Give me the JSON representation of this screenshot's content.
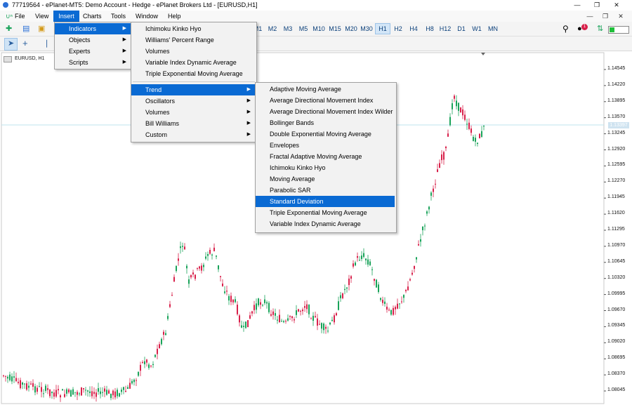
{
  "window": {
    "title": "77719564 - ePlanet-MT5: Demo Account - Hedge - ePlanet Brokers Ltd - [EURUSD,H1]",
    "minimize": "—",
    "maximize": "❐",
    "close": "✕"
  },
  "menubar": {
    "items": [
      "File",
      "View",
      "Insert",
      "Charts",
      "Tools",
      "Window",
      "Help"
    ],
    "active": "Insert"
  },
  "toolbar": {
    "timeframes": [
      "M1",
      "M2",
      "M3",
      "M5",
      "M10",
      "M15",
      "M20",
      "M30",
      "H1",
      "H2",
      "H4",
      "H8",
      "H12",
      "D1",
      "W1",
      "MN"
    ],
    "active_timeframe": "H1",
    "notification_count": "1"
  },
  "chart": {
    "symbol": "EURUSD, H1",
    "current_price": "1.13397",
    "price_labels": [
      "1.14545",
      "1.14220",
      "1.13895",
      "1.13570",
      "1.13245",
      "1.12920",
      "1.12595",
      "1.12270",
      "1.11945",
      "1.11620",
      "1.11295",
      "1.10970",
      "1.10645",
      "1.10320",
      "1.09995",
      "1.09670",
      "1.09345",
      "1.09020",
      "1.08695",
      "1.08370",
      "1.08045"
    ]
  },
  "insert_menu": {
    "items": [
      "Indicators",
      "Objects",
      "Experts",
      "Scripts"
    ],
    "highlighted": "Indicators"
  },
  "indicators_menu": {
    "recent": [
      "Ichimoku Kinko Hyo",
      "Williams' Percent Range",
      "Volumes",
      "Variable Index Dynamic Average",
      "Triple Exponential Moving Average"
    ],
    "categories": [
      "Trend",
      "Oscillators",
      "Volumes",
      "Bill Williams",
      "Custom"
    ],
    "highlighted": "Trend"
  },
  "trend_menu": {
    "items": [
      "Adaptive Moving Average",
      "Average Directional Movement Index",
      "Average Directional Movement Index Wilder",
      "Bollinger Bands",
      "Double Exponential Moving Average",
      "Envelopes",
      "Fractal Adaptive Moving Average",
      "Ichimoku Kinko Hyo",
      "Moving Average",
      "Parabolic SAR",
      "Standard Deviation",
      "Triple Exponential Moving Average",
      "Variable Index Dynamic Average"
    ],
    "highlighted": "Standard Deviation"
  },
  "colors": {
    "accent": "#0a6ad3",
    "bull_candle": "#1aa35a",
    "bear_candle": "#d8204a"
  }
}
